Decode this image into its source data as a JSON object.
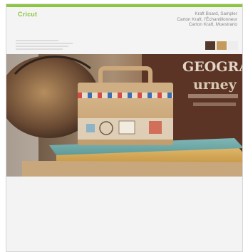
{
  "brand": {
    "name": "Cricut"
  },
  "product": {
    "titles": [
      "Kraft Board, Sampler",
      "Carton Kraft, l'Échantillonneur",
      "Carton Kraft, Muestrario"
    ]
  },
  "swatches": [
    {
      "color": "#4f3a2b"
    },
    {
      "color": "#c49a5e"
    },
    {
      "color": "#ededed"
    }
  ],
  "colors": {
    "accent": "#8cc63f"
  }
}
